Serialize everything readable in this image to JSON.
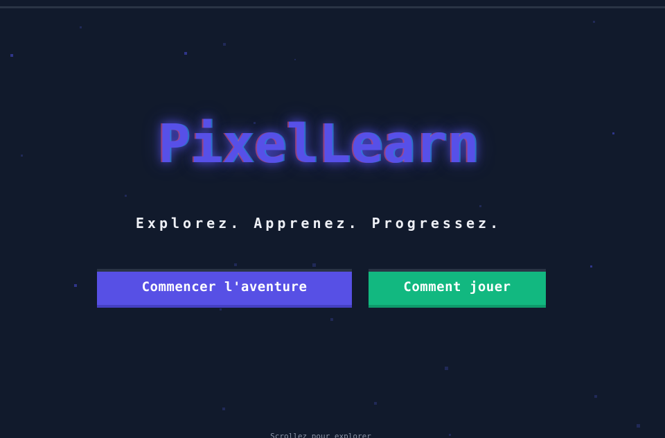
{
  "hero": {
    "title": "PixelLearn",
    "tagline": "Explorez. Apprenez. Progressez.",
    "primary_cta": "Commencer l'aventure",
    "secondary_cta": "Comment jouer",
    "scroll_hint": "Scrollez pour explorer"
  },
  "colors": {
    "background": "#111a2c",
    "brand": "#5750e8",
    "primary_button": "#5750e5",
    "secondary_button": "#12b880",
    "text": "#eef0f6"
  }
}
